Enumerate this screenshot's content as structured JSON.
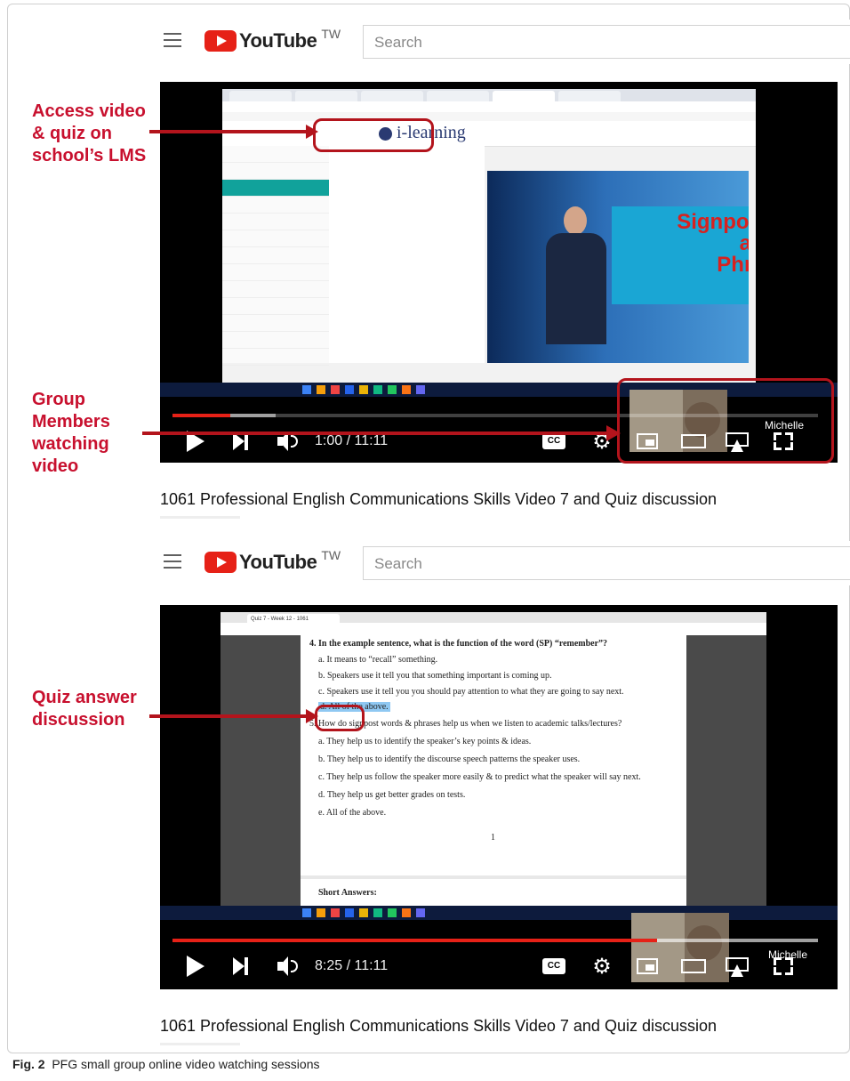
{
  "header_top": {
    "logo_text": "YouTube",
    "country": "TW",
    "search_placeholder": "Search"
  },
  "header_bottom": {
    "logo_text": "YouTube",
    "country": "TW",
    "search_placeholder": "Search"
  },
  "video1": {
    "time": "1:00 / 11:11",
    "progress_fraction": 0.09,
    "cc_label": "CC",
    "participant_name": "Michelle",
    "lms_logo": "i-learning",
    "slide_title": "Signpost Words\nand\nPhrases",
    "title": "1061 Professional English Communications Skills Video 7 and Quiz discussion"
  },
  "video2": {
    "time": "8:25 / 11:11",
    "progress_fraction": 0.75,
    "cc_label": "CC",
    "participant_name": "Michelle",
    "doc_tab": "Quiz 7 - Week 12 - 1061",
    "quiz": {
      "q4": "4. In the example sentence, what is the function of the word (SP) “remember”?",
      "q4a": "a.   It means to “recall” something.",
      "q4b": "b.   Speakers use it tell you that something important is coming up.",
      "q4c": "c.   Speakers use it tell you you should pay attention to what they are going to say next.",
      "q4d": "d.   All of the above.",
      "q5": "5. How do signpost words & phrases help us when we listen to academic talks/lectures?",
      "q5a": "a.   They help us to identify the speaker’s key points & ideas.",
      "q5b": "b.   They help us to identify the discourse speech patterns the speaker uses.",
      "q5c": "c.   They help us follow the speaker more easily & to predict what the speaker will say next.",
      "q5d": "d.   They help us get better grades on tests.",
      "q5e": "e.   All of the above.",
      "page_number": "1",
      "short_answers": "Short Answers:"
    },
    "title": "1061 Professional English Communications Skills Video 7 and Quiz discussion"
  },
  "annotations": {
    "lms": "Access video\n& quiz on\nschool’s LMS",
    "group": "Group\nMembers\nwatching\nvideo",
    "quiz": "Quiz answer\ndiscussion"
  },
  "caption": {
    "label": "Fig. 2",
    "text": "PFG small group online video watching sessions"
  },
  "colors": {
    "annotation_red": "#c8102e",
    "youtube_red": "#e62117"
  }
}
